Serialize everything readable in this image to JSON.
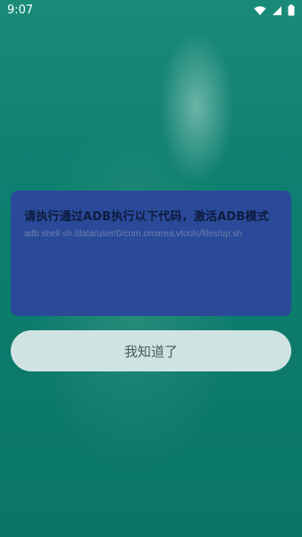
{
  "status_bar": {
    "time": "9:07",
    "icons": [
      "wifi-icon",
      "signal-icon",
      "battery-icon"
    ]
  },
  "dialog": {
    "title": "请执行通过ADB执行以下代码，激活ADB模式",
    "command": "adb shell sh /data/user/0/com.omarea.vtools/files/up.sh",
    "confirm_label": "我知道了"
  },
  "colors": {
    "background": "#0b7d6e",
    "card": "#2a4a99",
    "button": "#cfe3e2"
  }
}
